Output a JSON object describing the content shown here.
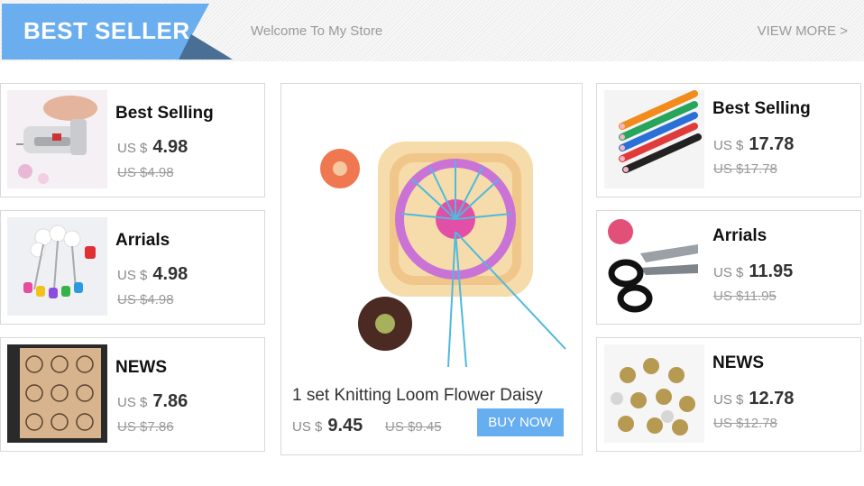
{
  "header": {
    "badge": "BEST SELLER",
    "welcome": "Welcome To My Store",
    "view_more": "VIEW MORE >"
  },
  "colors": {
    "badge_blue": "#6aaef0",
    "badge_dark": "#4a6f95",
    "buy_button": "#66aef0"
  },
  "left_cards": [
    {
      "title": "Best Selling",
      "currency": "US $",
      "price": "4.98",
      "old_price": "US $4.98",
      "image": "mini-sewing-machine"
    },
    {
      "title": "Arrials",
      "currency": "US $",
      "price": "4.98",
      "old_price": "US $4.98",
      "image": "pearl-pins"
    },
    {
      "title": "NEWS",
      "currency": "US $",
      "price": "7.86",
      "old_price": "US $7.86",
      "image": "flower-stencil-templates"
    }
  ],
  "featured": {
    "title": "1 set Knitting Loom Flower Daisy",
    "currency": "US $",
    "price": "9.45",
    "old_price": "US $9.45",
    "buy_label": "BUY NOW",
    "image": "flower-loom"
  },
  "right_cards": [
    {
      "title": "Best Selling",
      "currency": "US $",
      "price": "17.78",
      "old_price": "US $17.78",
      "image": "chalk-pencils"
    },
    {
      "title": "Arrials",
      "currency": "US $",
      "price": "11.95",
      "old_price": "US $11.95",
      "image": "pinking-shears"
    },
    {
      "title": "NEWS",
      "currency": "US $",
      "price": "12.78",
      "old_price": "US $12.78",
      "image": "metal-bells"
    }
  ]
}
